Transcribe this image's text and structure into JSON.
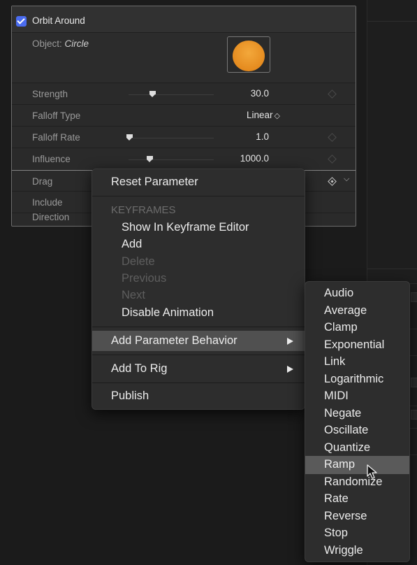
{
  "panel": {
    "header": {
      "label": "Orbit Around",
      "checked": true
    },
    "object": {
      "label": "Object:",
      "value": "Circle"
    },
    "rows": [
      {
        "label": "Strength",
        "value": "30.0"
      },
      {
        "label": "Falloff Type",
        "value": "Linear",
        "popup_glyph": "◇"
      },
      {
        "label": "Falloff Rate",
        "value": "1.0"
      },
      {
        "label": "Influence",
        "value": "1000.0"
      },
      {
        "label": "Drag"
      },
      {
        "label": "Include"
      },
      {
        "label": "Direction"
      }
    ]
  },
  "context_menu": {
    "reset": "Reset Parameter",
    "keyframes_header": "KEYFRAMES",
    "show_in_editor": "Show In Keyframe Editor",
    "add": "Add",
    "delete": "Delete",
    "previous": "Previous",
    "next": "Next",
    "disable_animation": "Disable Animation",
    "add_parameter_behavior": "Add Parameter Behavior",
    "add_to_rig": "Add To Rig",
    "publish": "Publish"
  },
  "submenu": {
    "items": [
      "Audio",
      "Average",
      "Clamp",
      "Exponential",
      "Link",
      "Logarithmic",
      "MIDI",
      "Negate",
      "Oscillate",
      "Quantize",
      "Ramp",
      "Randomize",
      "Rate",
      "Reverse",
      "Stop",
      "Wriggle"
    ],
    "highlighted": "Ramp"
  },
  "colors": {
    "checkbox": "#4a6cf0",
    "object_swatch": "#e8931f",
    "menu_highlight": "#505050"
  }
}
